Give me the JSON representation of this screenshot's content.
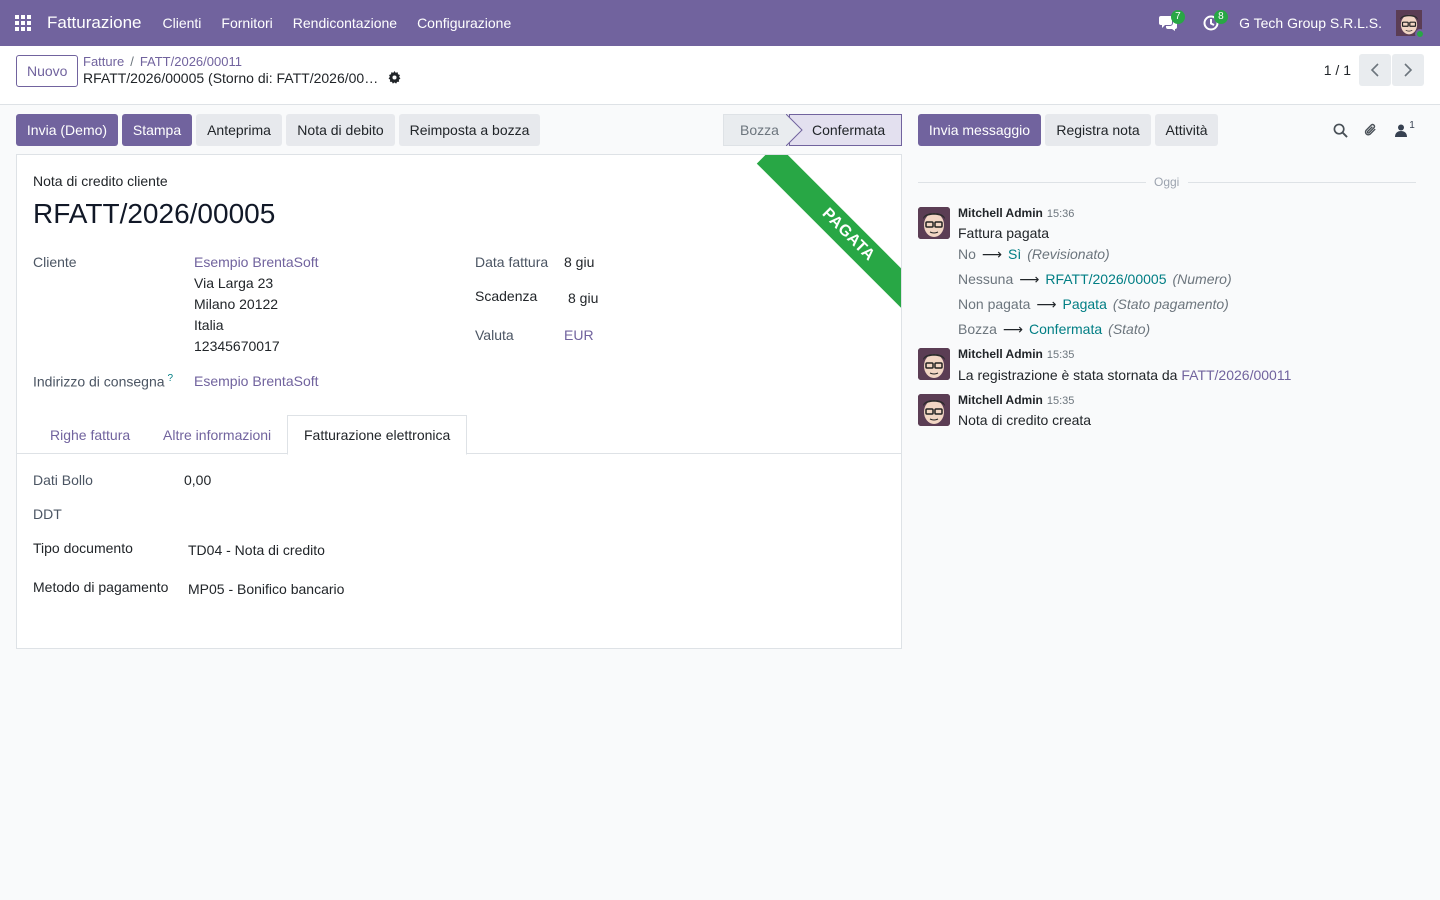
{
  "navbar": {
    "app_name": "Fatturazione",
    "menu": [
      "Clienti",
      "Fornitori",
      "Rendicontazione",
      "Configurazione"
    ],
    "messages_count": "7",
    "activities_count": "8",
    "company": "G Tech Group S.R.L.S."
  },
  "control": {
    "new_label": "Nuovo",
    "breadcrumb": [
      "Fatture",
      "FATT/2026/00011"
    ],
    "record_title": "RFATT/2026/00005 (Storno di: FATT/2026/00…",
    "pager": "1 / 1"
  },
  "actions": {
    "send": "Invia (Demo)",
    "print": "Stampa",
    "preview": "Anteprima",
    "debit_note": "Nota di debito",
    "reset": "Reimposta a bozza"
  },
  "status": {
    "draft": "Bozza",
    "confirmed": "Confermata"
  },
  "form": {
    "ribbon": "PAGATA",
    "doc_type": "Nota di credito cliente",
    "doc_name": "RFATT/2026/00005",
    "customer_label": "Cliente",
    "customer_name": "Esempio BrentaSoft",
    "address": [
      "Via Larga 23",
      "Milano 20122",
      "Italia",
      "12345670017"
    ],
    "delivery_label": "Indirizzo di consegna",
    "delivery_help": "?",
    "delivery_value": "Esempio BrentaSoft",
    "date_label": "Data fattura",
    "date_value": "8 giu",
    "due_label": "Scadenza",
    "due_value": "8 giu",
    "currency_label": "Valuta",
    "currency_value": "EUR",
    "tabs": [
      "Righe fattura",
      "Altre informazioni",
      "Fatturazione elettronica"
    ],
    "einvoice": {
      "stamp_label": "Dati Bollo",
      "stamp_value": "0,00",
      "ddt_label": "DDT",
      "doc_type_label": "Tipo documento",
      "doc_type_value": "TD04 - Nota di credito",
      "payment_label": "Metodo di pagamento",
      "payment_value": "MP05 - Bonifico bancario"
    }
  },
  "chatter": {
    "send_message": "Invia messaggio",
    "log_note": "Registra nota",
    "activities": "Attività",
    "followers_count": "1",
    "day": "Oggi",
    "messages": [
      {
        "author": "Mitchell Admin",
        "time": "15:36",
        "text": "Fattura pagata",
        "tracking": [
          {
            "old": "No",
            "new": "Sì",
            "field": "(Revisionato)"
          },
          {
            "old": "Nessuna",
            "new": "RFATT/2026/00005",
            "field": "(Numero)"
          },
          {
            "old": "Non pagata",
            "new": "Pagata",
            "field": "(Stato pagamento)"
          },
          {
            "old": "Bozza",
            "new": "Confermata",
            "field": "(Stato)"
          }
        ]
      },
      {
        "author": "Mitchell Admin",
        "time": "15:35",
        "text": "La registrazione è stata stornata da",
        "link": "FATT/2026/00011"
      },
      {
        "author": "Mitchell Admin",
        "time": "15:35",
        "text": "Nota di credito creata"
      }
    ]
  }
}
